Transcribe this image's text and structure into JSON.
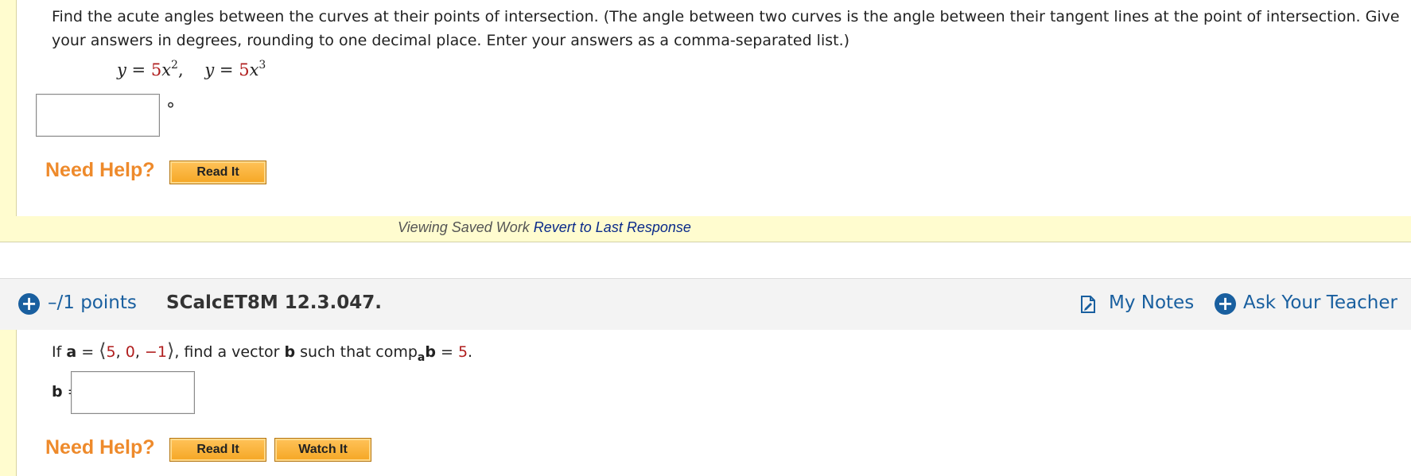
{
  "question1": {
    "instructions": "Find the acute angles between the curves at their points of intersection. (The angle between two curves is the angle between their tangent lines at the point of intersection. Give your answers in degrees, rounding to one decimal place. Enter your answers as a comma-separated list.)",
    "eq1_lhs": "y",
    "eq1_eq": " = ",
    "eq1_coef": "5",
    "eq1_var": "x",
    "eq1_exp": "2",
    "eq_sep": ",",
    "eq2_lhs": "y",
    "eq2_eq": " = ",
    "eq2_coef": "5",
    "eq2_var": "x",
    "eq2_exp": "3",
    "answer_value": "",
    "degree_symbol": "°",
    "need_help": "Need Help?",
    "read_it": "Read It"
  },
  "saved_bar": {
    "viewing": "Viewing Saved Work",
    "revert": "Revert to Last Response"
  },
  "question2": {
    "points": "–/1 points",
    "id": "SCalcET8M 12.3.047.",
    "my_notes": "My Notes",
    "ask_teacher": "Ask Your Teacher",
    "text_if": "If ",
    "vec_a": "a",
    "eq": " = ",
    "langle": "⟨",
    "comp1": "5",
    "comma1": ", ",
    "comp2": "0",
    "comma2": ", ",
    "comp3": "−1",
    "rangle": "⟩",
    "text_find": ", find a vector ",
    "vec_b": "b",
    "text_such": " such that comp",
    "sub_a": "a",
    "vec_b2": "b",
    "eq2": " = ",
    "rhs": "5",
    "period": ".",
    "b_label": "b",
    "b_eq": " =",
    "answer_value": "",
    "need_help": "Need Help?",
    "read_it": "Read It",
    "watch_it": "Watch It"
  },
  "colors": {
    "accent_blue": "#195f9f",
    "help_orange": "#ee8a2b",
    "value_red": "#b01e1e",
    "panel_yellow": "#fffccf"
  },
  "icons": [
    "plus-circle-icon",
    "notes-icon"
  ]
}
